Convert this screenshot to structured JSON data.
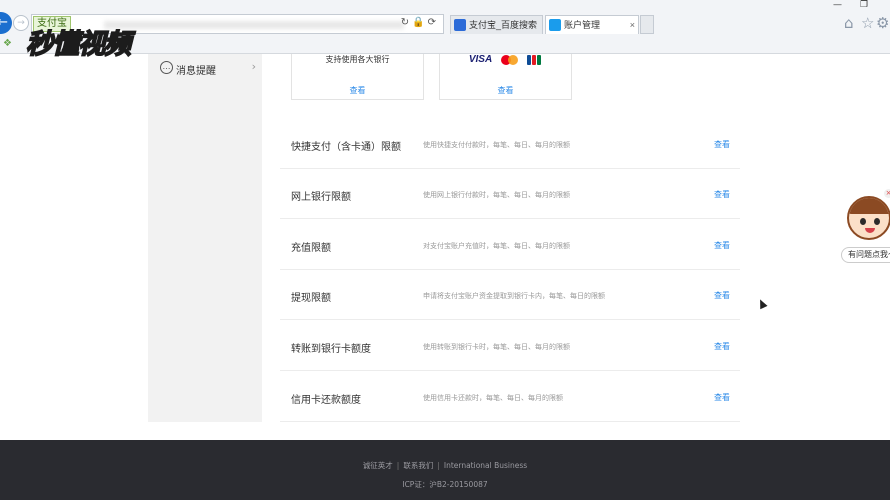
{
  "browser": {
    "address_site_badge": "支付宝",
    "tabs": [
      {
        "label": "支付宝_百度搜索"
      },
      {
        "label": "账户管理"
      }
    ],
    "window": {
      "minimize": "—",
      "maximize": "❐"
    }
  },
  "watermark": {
    "text": "秒懂视频"
  },
  "sidebar": {
    "items": [
      {
        "label": "消息提醒"
      }
    ]
  },
  "cards": [
    {
      "description": "支持使用各大银行",
      "link": "查看"
    },
    {
      "logos": [
        "VISA",
        "mastercard",
        "JCB"
      ],
      "link": "查看"
    }
  ],
  "limits": [
    {
      "title": "快捷支付（含卡通）限额",
      "description": "使用快捷支付付款时，每笔、每日、每月的限额",
      "link": "查看"
    },
    {
      "title": "网上银行限额",
      "description": "使用网上银行付款时，每笔、每日、每月的限额",
      "link": "查看"
    },
    {
      "title": "充值限额",
      "description": "对支付宝账户充值时，每笔、每日、每月的限额",
      "link": "查看"
    },
    {
      "title": "提现限额",
      "description": "申请将支付宝账户资金提取到银行卡内，每笔、每日的限额",
      "link": "查看"
    },
    {
      "title": "转账到银行卡额度",
      "description": "使用转账到银行卡时，每笔、每日、每月的限额",
      "link": "查看"
    },
    {
      "title": "信用卡还款额度",
      "description": "使用信用卡还款时，每笔、每日、每月的限额",
      "link": "查看"
    }
  ],
  "footer": {
    "links": [
      "诚征英才",
      "联系我们",
      "International Business"
    ],
    "separator": "|",
    "icp": "ICP证：沪B2-20150087"
  },
  "helper": {
    "bubble_text": "有问题点我～"
  }
}
